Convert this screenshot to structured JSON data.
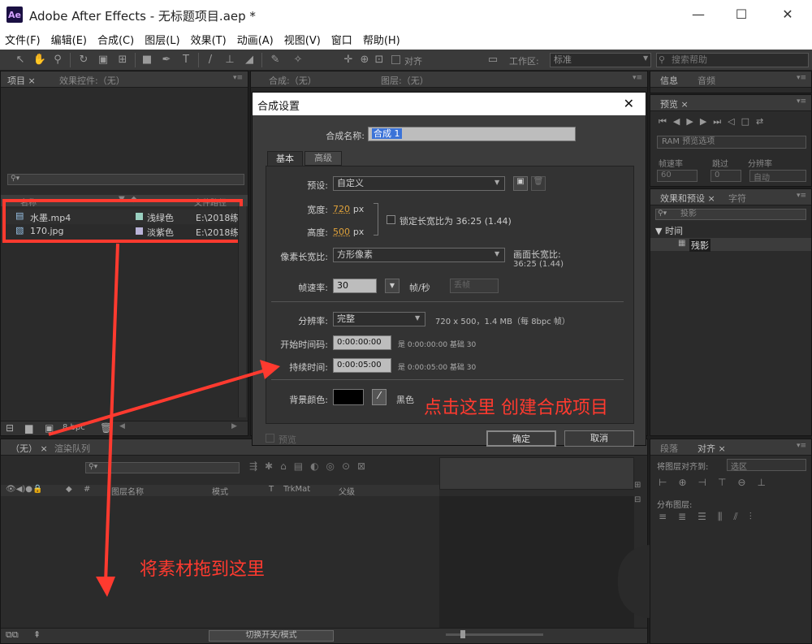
{
  "window": {
    "logo": "Ae",
    "title": "Adobe After Effects - 无标题项目.aep *",
    "minimize": "—",
    "maximize": "☐",
    "close": "✕"
  },
  "menu": [
    "文件(F)",
    "编辑(E)",
    "合成(C)",
    "图层(L)",
    "效果(T)",
    "动画(A)",
    "视图(V)",
    "窗口",
    "帮助(H)"
  ],
  "toolbar": {
    "align_label": "对齐",
    "workspace_label": "工作区:",
    "workspace_value": "标准",
    "search_placeholder": "搜索帮助"
  },
  "project_panel": {
    "tabs": [
      "项目 ×",
      "效果控件:（无）"
    ],
    "columns": {
      "name": "名称",
      "path": "文件路径"
    },
    "items": [
      {
        "name": "水墨.mp4",
        "label": "浅绿色",
        "path": "E:\\2018练",
        "color": "#9ad0c0"
      },
      {
        "name": "170.jpg",
        "label": "淡紫色",
        "path": "E:\\2018练",
        "color": "#b9b3d8"
      }
    ],
    "bpc": "8 bpc"
  },
  "comp_viewer": {
    "tabs": [
      "合成:（无）",
      "图层:（无）"
    ]
  },
  "right_panels": {
    "info_tabs": [
      "信息",
      "音频"
    ],
    "preview_tab": "预览 ×",
    "ram_preview": "RAM 预览选项",
    "frame_rate_label": "帧速率",
    "skip_label": "跳过",
    "resolution_label": "分辨率",
    "frame_rate_value": "60",
    "skip_value": "0",
    "resolution_value": "自动",
    "effects_tabs": [
      "效果和预设 ×",
      "字符"
    ],
    "effects_search": "投影",
    "effects_group": "时间",
    "effects_item": "残影",
    "align_tabs": [
      "段落",
      "对齐 ×"
    ],
    "align_to_label": "将图层对齐到:",
    "align_to_value": "选区",
    "distribute_label": "分布图层:"
  },
  "timeline": {
    "tabs": [
      "（无） ×",
      "渲染队列"
    ],
    "columns": [
      "图层名称",
      "模式",
      "T",
      "TrkMat",
      "父级"
    ],
    "toggle_label": "切换开关/模式"
  },
  "dialog": {
    "title": "合成设置",
    "comp_name_label": "合成名称:",
    "comp_name_value": "合成 1",
    "tab_basic": "基本",
    "tab_advanced": "高级",
    "preset_label": "预设:",
    "preset_value": "自定义",
    "width_label": "宽度:",
    "width_value": "720",
    "height_label": "高度:",
    "height_value": "500",
    "px": "px",
    "lock_aspect": "锁定长宽比为 36:25 (1.44)",
    "pixel_aspect_label": "像素长宽比:",
    "pixel_aspect_value": "方形像素",
    "frame_aspect_label": "画面长宽比:",
    "frame_aspect_value": "36:25 (1.44)",
    "frame_rate_label": "帧速率:",
    "frame_rate_value": "30",
    "fps_unit": "帧/秒",
    "drop_frame": "丢帧",
    "resolution_label": "分辨率:",
    "resolution_value": "完整",
    "resolution_info": "720 x 500，1.4 MB（每 8bpc 帧）",
    "start_tc_label": "开始时间码:",
    "start_tc_value": "0:00:00:00",
    "start_tc_info": "是 0:00:00:00  基础 30",
    "duration_label": "持续时间:",
    "duration_value": "0:00:05:00",
    "duration_info": "是 0:00:05:00  基础 30",
    "bg_color_label": "背景颜色:",
    "bg_color_name": "黑色",
    "preview_label": "预览",
    "ok": "确定",
    "cancel": "取消",
    "close": "✕"
  },
  "annotations": {
    "create_comp": "点击这里 创建合成项目",
    "drag_here": "将素材拖到这里"
  }
}
